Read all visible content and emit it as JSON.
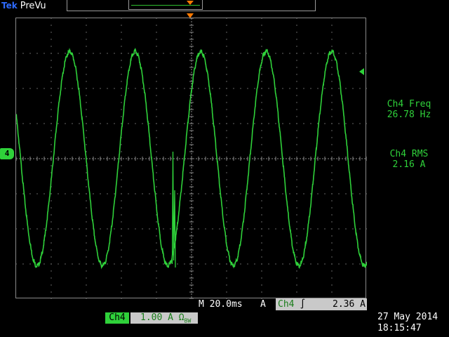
{
  "header": {
    "brand": "Tek",
    "mode": "PreVu"
  },
  "channel": {
    "marker_label": "4",
    "name": "Ch4",
    "vertical_scale": "1.00 A",
    "coupling_symbol": "Ω",
    "bw_symbol": "BW",
    "trace_color": "#2fd13a"
  },
  "measurements": [
    {
      "label": "Ch4 Freq",
      "value": "26.78 Hz"
    },
    {
      "label": "Ch4 RMS",
      "value": "2.16 A"
    }
  ],
  "timebase": {
    "text": "M 20.0ms"
  },
  "acquisition": {
    "mode": "A"
  },
  "trigger": {
    "source": "Ch4",
    "slope_symbol": "∫",
    "level": "2.36 A"
  },
  "datetime": {
    "date": "27 May 2014",
    "time": "18:15:47"
  },
  "colors": {
    "accent_green": "#2fd13a",
    "trigger_marker": "#ff7a00",
    "brand_blue": "#2e6bff",
    "graticule": "#8a8a8a"
  },
  "chart_data": {
    "type": "line",
    "series": [
      {
        "frequency_hz": 26.78,
        "rms_a": 2.16,
        "peak_a": 3.05,
        "offset_a": 0.0
      }
    ],
    "xlim_ms": [
      -100,
      100
    ],
    "ylim_a": [
      -4,
      4
    ],
    "grid": true
  }
}
